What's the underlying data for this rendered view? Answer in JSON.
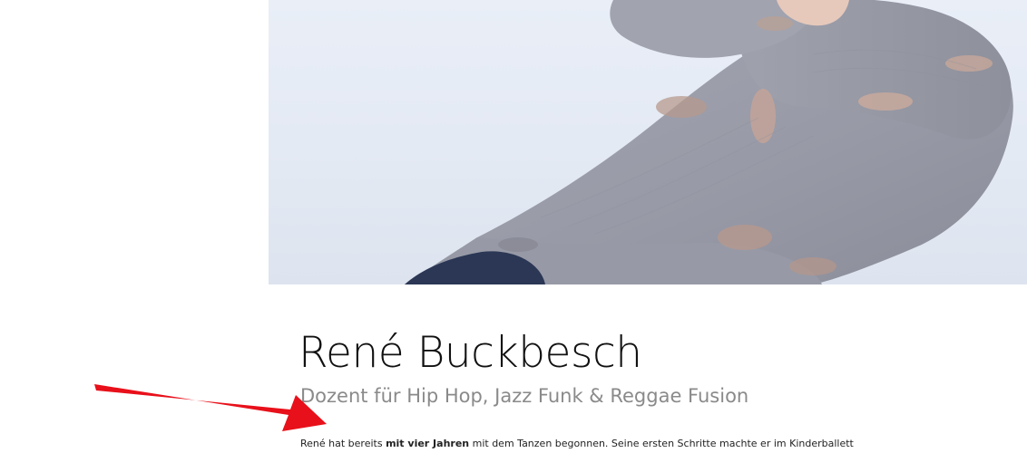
{
  "profile": {
    "name": "René Buckbesch",
    "role": "Dozent für Hip Hop, Jazz Funk & Reggae Fusion",
    "bio_prefix": "René hat bereits ",
    "bio_bold": "mit vier Jahren",
    "bio_suffix": " mit dem Tanzen begonnen. Seine ersten Schritte machte er im Kinderballett"
  },
  "hero_image": {
    "icon": "dancer-photo",
    "background_color": "#e5ebf4",
    "sweater_color": "#9a9ca8",
    "jeans_color": "#2a3652"
  },
  "annotation": {
    "icon": "red-arrow-icon",
    "color": "#e8101a"
  }
}
